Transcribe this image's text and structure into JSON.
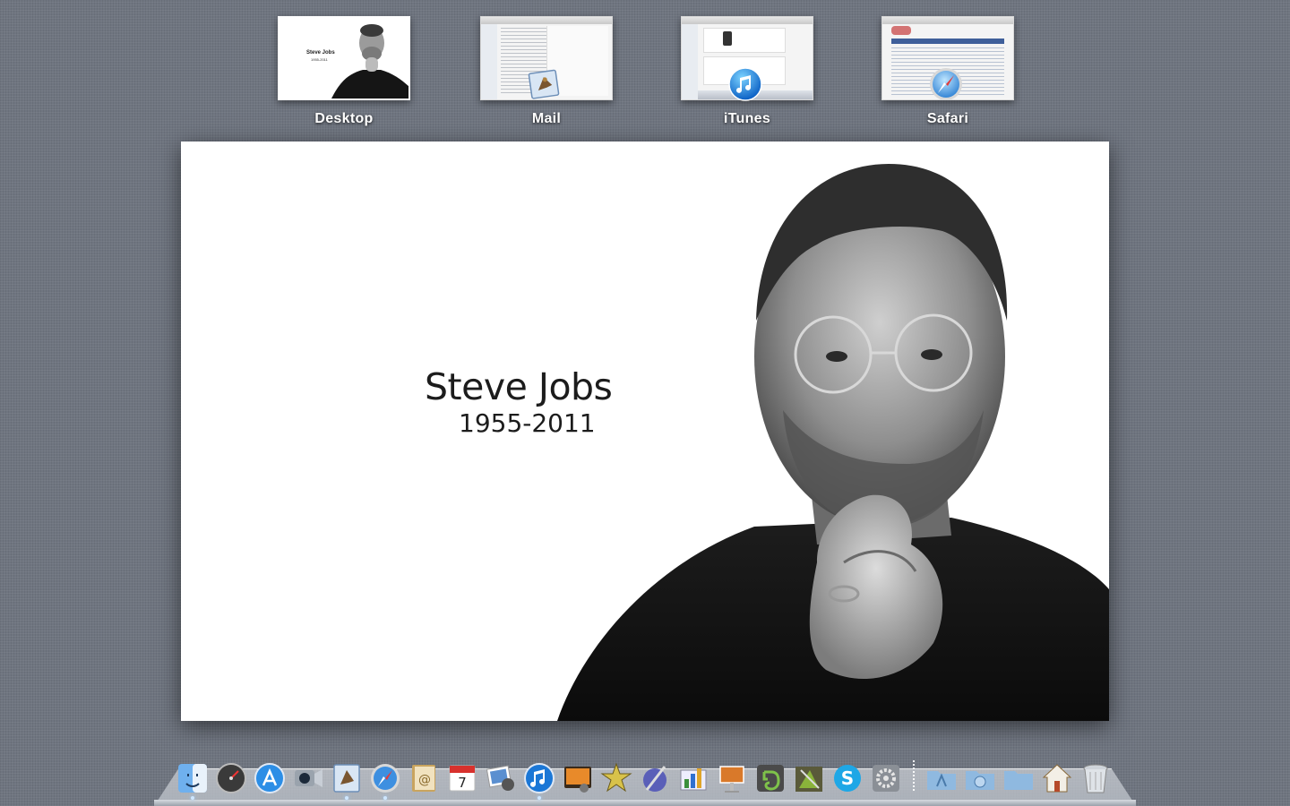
{
  "spaces": [
    {
      "label": "Desktop",
      "type": "desktop"
    },
    {
      "label": "Mail",
      "type": "mail"
    },
    {
      "label": "iTunes",
      "type": "itunes"
    },
    {
      "label": "Safari",
      "type": "safari"
    }
  ],
  "desktop_thumb": {
    "title": "Steve Jobs",
    "years": "1955-2011"
  },
  "wallpaper": {
    "name": "Steve Jobs",
    "years": "1955-2011"
  },
  "dock": {
    "apps": [
      "finder-icon",
      "dashboard-icon",
      "app-store-icon",
      "facetime-icon",
      "mail-icon",
      "safari-icon",
      "address-book-icon",
      "ical-icon",
      "iphoto-icon",
      "itunes-icon",
      "photo-booth-icon",
      "imovie-icon",
      "preview-pen-icon",
      "numbers-icon",
      "keynote-icon",
      "evernote-icon",
      "gimp-icon",
      "skype-icon",
      "system-preferences-icon"
    ],
    "stacks": [
      "applications-folder-icon",
      "downloads-folder-icon",
      "documents-folder-icon",
      "home-icon",
      "trash-icon"
    ]
  },
  "colors": {
    "background": "#6f7580",
    "label": "#ffffff"
  }
}
